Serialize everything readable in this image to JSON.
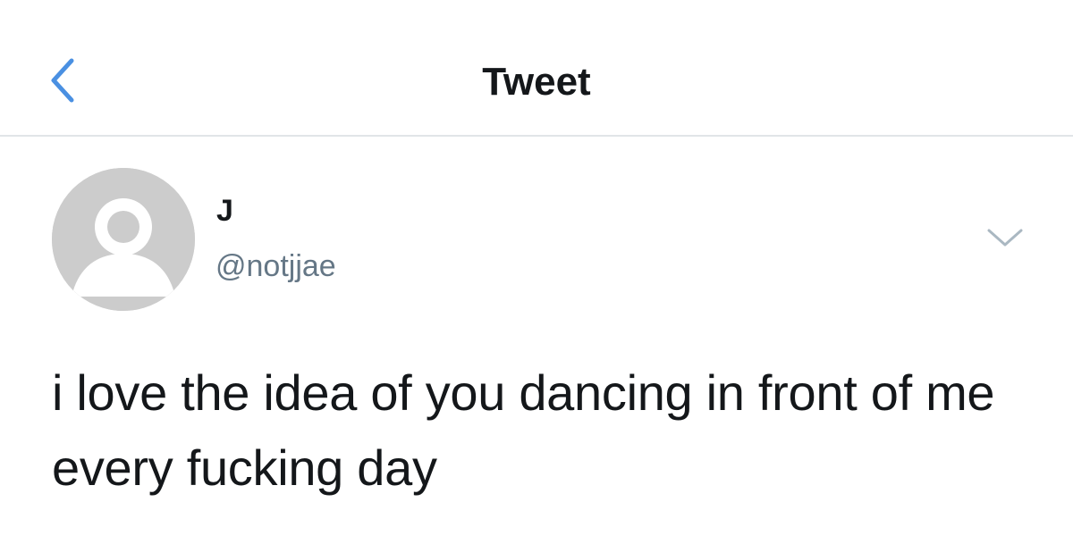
{
  "header": {
    "title": "Tweet",
    "back_icon": "chevron-left-icon",
    "accent_color": "#4a90e2"
  },
  "tweet": {
    "author": {
      "display_name": "J",
      "handle": "@notjjae",
      "avatar_icon": "default-profile-avatar"
    },
    "menu_icon": "chevron-down-icon",
    "text": "i love the idea of you dancing in front of me every fucking day"
  }
}
